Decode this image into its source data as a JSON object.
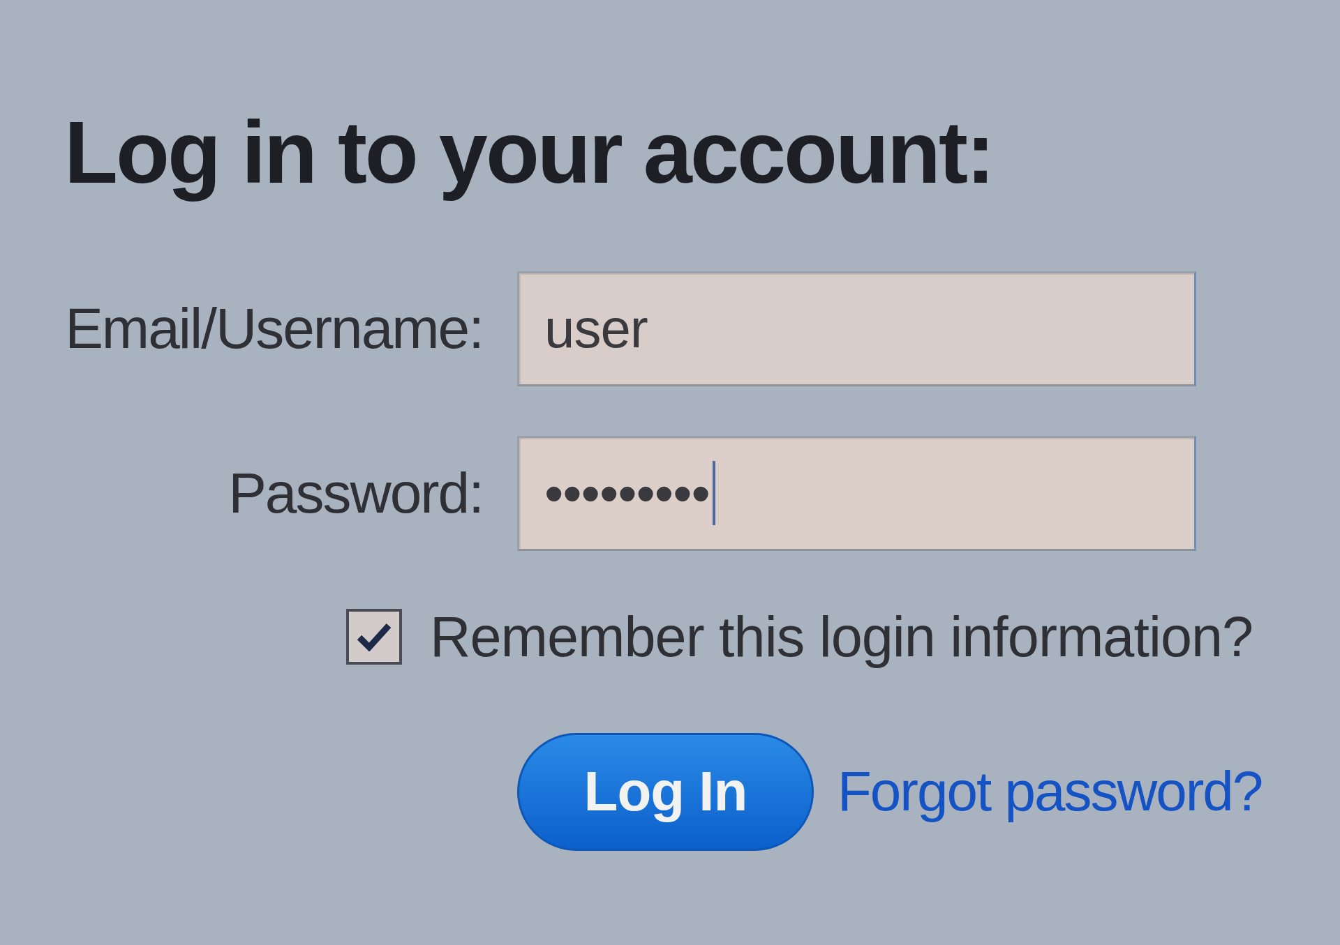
{
  "heading": "Log in to your account:",
  "fields": [
    {
      "label": "Email/Username:",
      "value": "user",
      "focused": false
    },
    {
      "label": "Password:",
      "value": "•••••••••",
      "focused": true
    }
  ],
  "remember": {
    "label": "Remember this login information?",
    "checked": true
  },
  "login_button": "Log In",
  "forgot_link": "Forgot password?"
}
